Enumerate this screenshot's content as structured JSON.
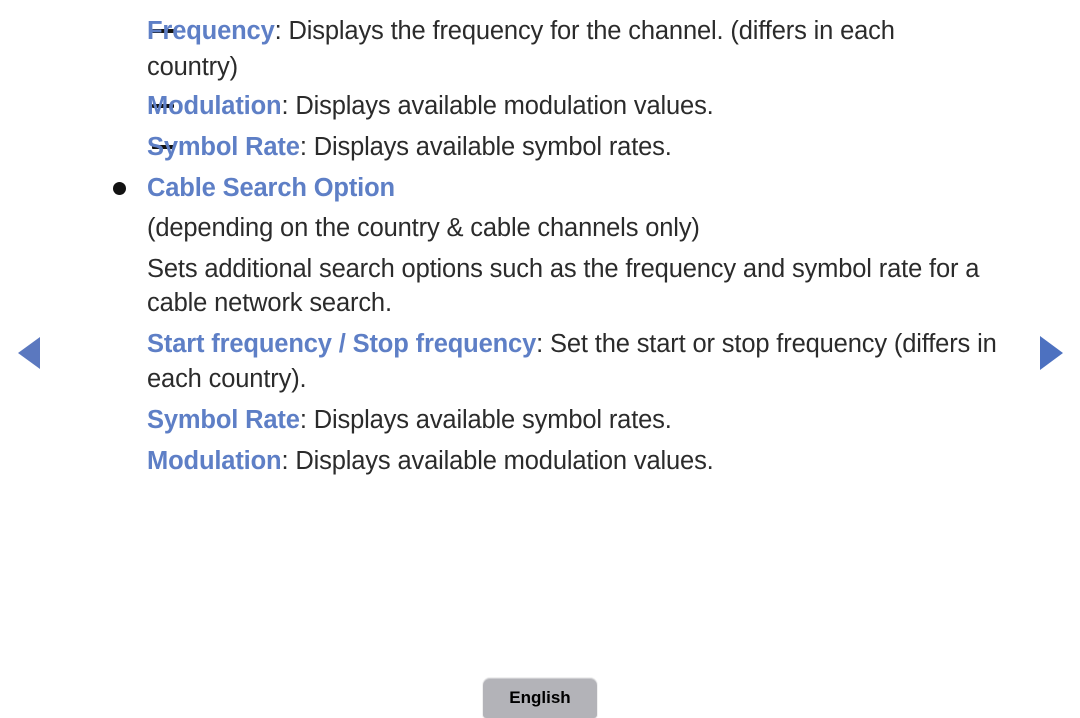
{
  "page": {
    "background_color": "#ffffff",
    "accent_color": "#5e7fc6",
    "text_color": "#2b2b2b"
  },
  "navigation": {
    "prev": {
      "icon": "triangle-left-icon",
      "label": "Previous page",
      "color": "#5b78bf"
    },
    "next": {
      "icon": "triangle-right-icon",
      "label": "Next page",
      "color": "#4d71c0"
    }
  },
  "footer": {
    "language_button": {
      "label": "English",
      "background_color": "#b3b3b8"
    }
  },
  "content": {
    "sub_items": [
      {
        "marker": "dash",
        "term": "Frequency",
        "separator": ": ",
        "desc_line1": "Displays the frequency for the channel. (differs in each",
        "desc_line2": "country)"
      },
      {
        "marker": "dash",
        "term": "Modulation",
        "separator": ": ",
        "desc_line1": "Displays available modulation values."
      },
      {
        "marker": "dash",
        "term": "Symbol Rate",
        "separator": ": ",
        "desc_line1": "Displays available symbol rates."
      }
    ],
    "bullet_heading": {
      "marker": "bullet",
      "text": "Cable Search Option"
    },
    "note": "(depending on the country & cable channels only)",
    "paragraph": {
      "line1": "Sets additional search options such as the frequency and symbol rate for a",
      "line2": "cable network search."
    },
    "entries": [
      {
        "term": "Start frequency / Stop frequency",
        "separator": ": ",
        "desc_line1": "Set the start or stop frequency (differs in",
        "desc_line2": "each country)."
      },
      {
        "term": "Symbol Rate",
        "separator": ": ",
        "desc_line1": "Displays available symbol rates."
      },
      {
        "term": "Modulation",
        "separator": ": ",
        "desc_line1": "Displays available modulation values."
      }
    ]
  }
}
